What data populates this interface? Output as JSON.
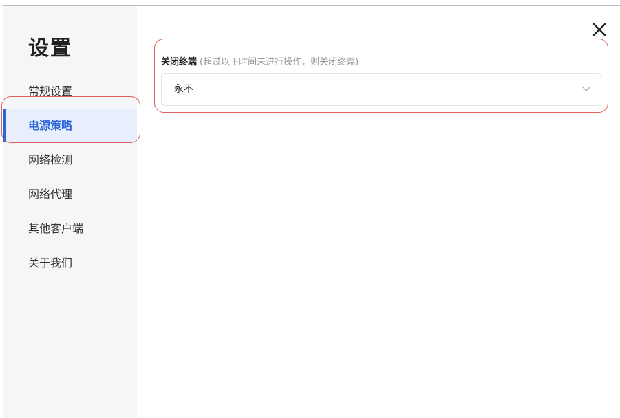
{
  "sidebar": {
    "title": "设置",
    "items": [
      {
        "label": "常规设置"
      },
      {
        "label": "电源策略"
      },
      {
        "label": "网络检测"
      },
      {
        "label": "网络代理"
      },
      {
        "label": "其他客户端"
      },
      {
        "label": "关于我们"
      }
    ],
    "active_index": 1
  },
  "main": {
    "field": {
      "label": "关闭终端",
      "hint": "(超过以下时间未进行操作，则关闭终端)",
      "selected_value": "永不"
    }
  },
  "icons": {
    "close": "close-icon",
    "dropdown": "chevron-down-icon"
  },
  "colors": {
    "accent": "#2a64d8",
    "highlight": "#e06060",
    "sidebar_bg": "#f5f6f8"
  }
}
